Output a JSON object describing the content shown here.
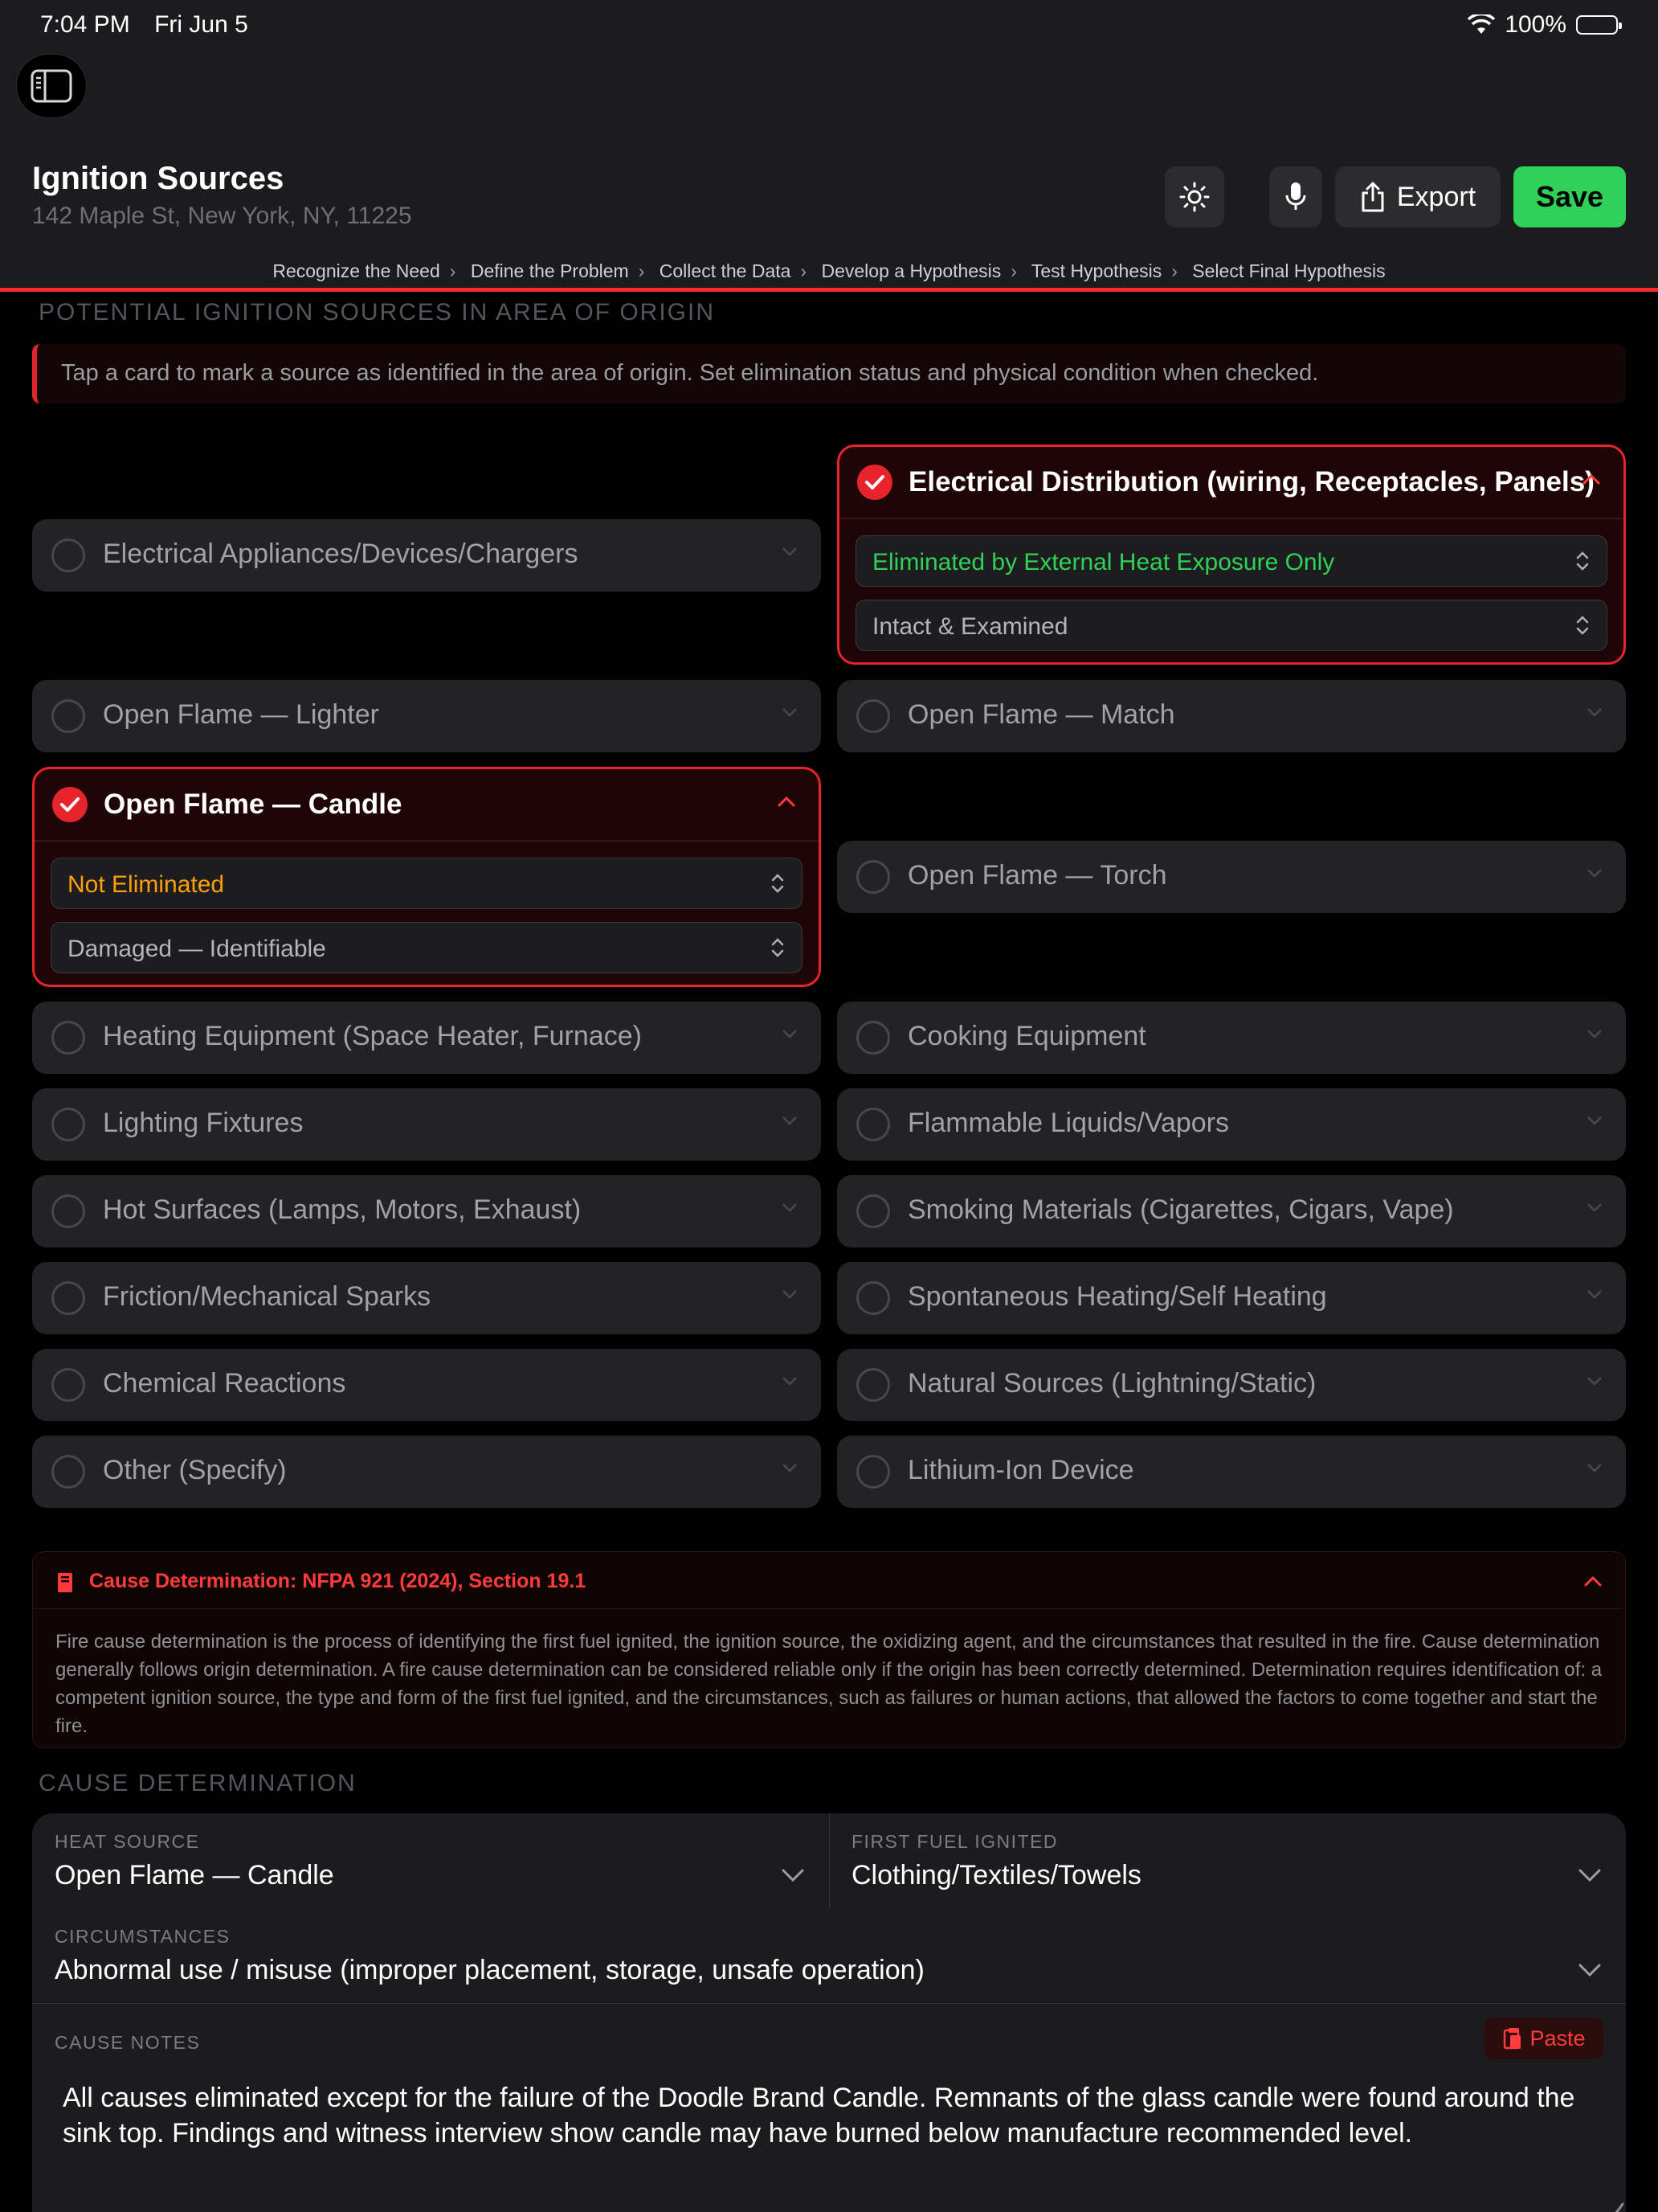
{
  "status_bar": {
    "time": "7:04 PM",
    "date": "Fri Jun 5",
    "battery": "100%"
  },
  "header": {
    "title": "Ignition Sources",
    "address": "142 Maple St, New York, NY, 11225",
    "export_label": "Export",
    "save_label": "Save"
  },
  "breadcrumb": [
    "Recognize the Need",
    "Define the Problem",
    "Collect the Data",
    "Develop a Hypothesis",
    "Test Hypothesis",
    "Select Final Hypothesis"
  ],
  "potential": {
    "heading": "POTENTIAL IGNITION SOURCES IN AREA OF ORIGIN",
    "hint": "Tap a card to mark a source as identified in the area of origin. Set elimination status and physical condition when checked."
  },
  "sources": {
    "electrical_distribution": {
      "label": "Electrical Distribution (wiring, Receptacles, Panels)",
      "checked": true,
      "elimination": "Eliminated by External Heat Exposure Only",
      "condition": "Intact & Examined"
    },
    "electrical_appliances": {
      "label": "Electrical Appliances/Devices/Chargers",
      "checked": false
    },
    "open_flame_lighter": {
      "label": "Open Flame — Lighter",
      "checked": false
    },
    "open_flame_match": {
      "label": "Open Flame — Match",
      "checked": false
    },
    "open_flame_candle": {
      "label": "Open Flame — Candle",
      "checked": true,
      "elimination": "Not Eliminated",
      "condition": "Damaged — Identifiable"
    },
    "open_flame_torch": {
      "label": "Open Flame — Torch",
      "checked": false
    },
    "heating_equipment": {
      "label": "Heating Equipment (Space Heater, Furnace)",
      "checked": false
    },
    "cooking_equipment": {
      "label": "Cooking Equipment",
      "checked": false
    },
    "lighting_fixtures": {
      "label": "Lighting Fixtures",
      "checked": false
    },
    "flammable_liquids": {
      "label": "Flammable Liquids/Vapors",
      "checked": false
    },
    "hot_surfaces": {
      "label": "Hot Surfaces (Lamps, Motors, Exhaust)",
      "checked": false
    },
    "smoking_materials": {
      "label": "Smoking Materials (Cigarettes, Cigars, Vape)",
      "checked": false
    },
    "friction_sparks": {
      "label": "Friction/Mechanical Sparks",
      "checked": false
    },
    "spontaneous_heating": {
      "label": "Spontaneous Heating/Self Heating",
      "checked": false
    },
    "chemical_reactions": {
      "label": "Chemical Reactions",
      "checked": false
    },
    "natural_sources": {
      "label": "Natural Sources (Lightning/Static)",
      "checked": false
    },
    "other": {
      "label": "Other (Specify)",
      "checked": false
    },
    "lithium_ion": {
      "label": "Lithium-Ion Device",
      "checked": false
    }
  },
  "reference": {
    "title": "Cause Determination: NFPA 921 (2024), Section 19.1",
    "body": "Fire cause determination is the process of identifying the first fuel ignited, the ignition source, the oxidizing agent, and the circumstances that resulted in the fire. Cause determination generally follows origin determination. A fire cause determination can be considered reliable only if the origin has been correctly determined. Determination requires identification of: a competent ignition source, the type and form of the first fuel ignited, and the circumstances, such as failures or human actions, that allowed the factors to come together and start the fire."
  },
  "cause": {
    "heading": "CAUSE DETERMINATION",
    "heat_source_label": "HEAT SOURCE",
    "heat_source_value": "Open Flame — Candle",
    "first_fuel_label": "FIRST FUEL IGNITED",
    "first_fuel_value": "Clothing/Textiles/Towels",
    "circumstances_label": "CIRCUMSTANCES",
    "circumstances_value": "Abnormal use / misuse (improper placement, storage, unsafe operation)",
    "notes_label": "CAUSE NOTES",
    "paste_label": "Paste",
    "notes_text": "All causes eliminated except for the failure of the Doodle Brand Candle. Remnants of the glass candle were found around the sink top. Findings and witness interview show candle may have burned below manufacture recommended level."
  },
  "colors": {
    "accent_red": "#e7242b",
    "save_green": "#30d158",
    "eliminated_green": "#30d158",
    "not_eliminated_orange": "#ff9f0a"
  }
}
